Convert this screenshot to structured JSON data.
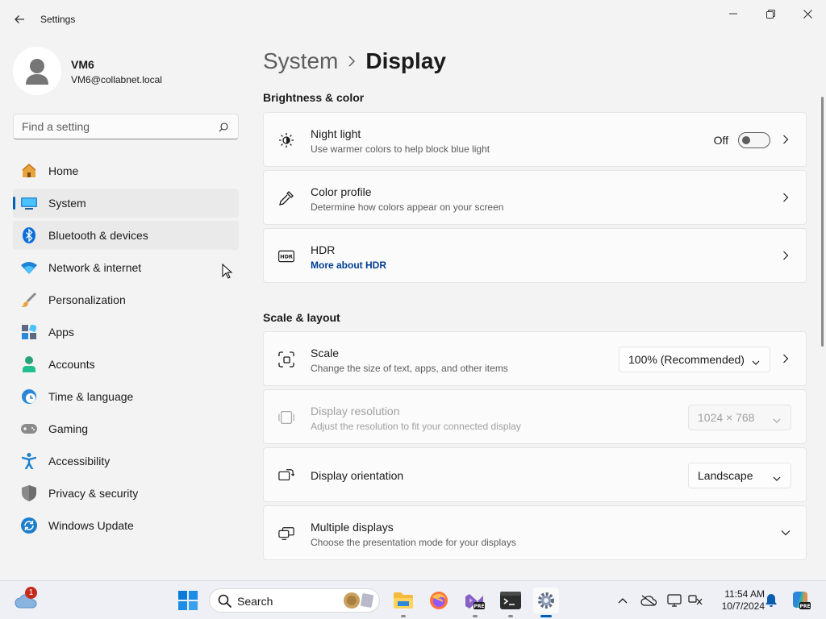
{
  "window": {
    "title": "Settings"
  },
  "user": {
    "name": "VM6",
    "email": "VM6@collabnet.local"
  },
  "search": {
    "placeholder": "Find a setting"
  },
  "sidebar": {
    "items": [
      {
        "label": "Home",
        "icon": "home-icon",
        "selected": false
      },
      {
        "label": "System",
        "icon": "system-icon",
        "selected": true
      },
      {
        "label": "Bluetooth & devices",
        "icon": "bluetooth-icon",
        "selected": false,
        "hover": true
      },
      {
        "label": "Network & internet",
        "icon": "wifi-icon",
        "selected": false
      },
      {
        "label": "Personalization",
        "icon": "brush-icon",
        "selected": false
      },
      {
        "label": "Apps",
        "icon": "apps-icon",
        "selected": false
      },
      {
        "label": "Accounts",
        "icon": "accounts-icon",
        "selected": false
      },
      {
        "label": "Time & language",
        "icon": "globe-clock-icon",
        "selected": false
      },
      {
        "label": "Gaming",
        "icon": "gamepad-icon",
        "selected": false
      },
      {
        "label": "Accessibility",
        "icon": "accessibility-icon",
        "selected": false
      },
      {
        "label": "Privacy & security",
        "icon": "shield-icon",
        "selected": false
      },
      {
        "label": "Windows Update",
        "icon": "update-icon",
        "selected": false
      }
    ]
  },
  "breadcrumb": {
    "parent": "System",
    "current": "Display"
  },
  "sections": {
    "brightness": {
      "title": "Brightness & color",
      "night_light": {
        "title": "Night light",
        "subtitle": "Use warmer colors to help block blue light",
        "toggle_label": "Off",
        "on": false
      },
      "color_profile": {
        "title": "Color profile",
        "subtitle": "Determine how colors appear on your screen"
      },
      "hdr": {
        "title": "HDR",
        "link": "More about HDR"
      }
    },
    "scale_layout": {
      "title": "Scale & layout",
      "scale": {
        "title": "Scale",
        "subtitle": "Change the size of text, apps, and other items",
        "value": "100% (Recommended)"
      },
      "resolution": {
        "title": "Display resolution",
        "subtitle": "Adjust the resolution to fit your connected display",
        "value": "1024 × 768",
        "disabled": true
      },
      "orientation": {
        "title": "Display orientation",
        "value": "Landscape"
      },
      "multiple": {
        "title": "Multiple displays",
        "subtitle": "Choose the presentation mode for your displays"
      }
    }
  },
  "taskbar": {
    "search_label": "Search",
    "weather_badge": "1",
    "time": "11:54 AM",
    "date": "10/7/2024",
    "accent": "#005fb8"
  }
}
